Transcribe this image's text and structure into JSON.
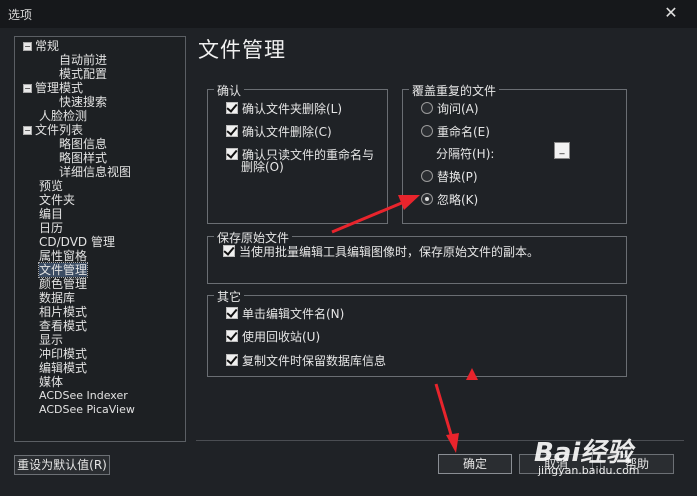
{
  "window": {
    "title": "选项",
    "close_glyph": "✕"
  },
  "tree": {
    "items": [
      {
        "label": "常规",
        "toggle": "−"
      },
      {
        "label": "自动前进"
      },
      {
        "label": "模式配置"
      },
      {
        "label": "管理模式",
        "toggle": "−"
      },
      {
        "label": "快速搜索"
      },
      {
        "label": "人脸检测"
      },
      {
        "label": "文件列表",
        "toggle": "−"
      },
      {
        "label": "略图信息"
      },
      {
        "label": "略图样式"
      },
      {
        "label": "详细信息视图"
      },
      {
        "label": "预览"
      },
      {
        "label": "文件夹"
      },
      {
        "label": "编目"
      },
      {
        "label": "日历"
      },
      {
        "label": "CD/DVD 管理"
      },
      {
        "label": "属性窗格"
      },
      {
        "label": "文件管理",
        "selected": true
      },
      {
        "label": "颜色管理"
      },
      {
        "label": "数据库"
      },
      {
        "label": "相片模式"
      },
      {
        "label": "查看模式"
      },
      {
        "label": "显示"
      },
      {
        "label": "冲印模式"
      },
      {
        "label": "编辑模式"
      },
      {
        "label": "媒体"
      },
      {
        "label": "ACDSee Indexer"
      },
      {
        "label": "ACDSee PicaView"
      }
    ]
  },
  "page_title": "文件管理",
  "confirm_group": {
    "legend": "确认",
    "items": [
      {
        "label": "确认文件夹删除(L)",
        "checked": true
      },
      {
        "label": "确认文件删除(C)",
        "checked": true
      },
      {
        "label": "确认只读文件的重命名与",
        "label2": "删除(O)",
        "checked": true
      }
    ]
  },
  "overwrite_group": {
    "legend": "覆盖重复的文件",
    "options": [
      {
        "label": "询问(A)",
        "selected": false
      },
      {
        "label": "重命名(E)",
        "selected": false
      },
      {
        "label": "替换(P)",
        "selected": false
      },
      {
        "label": "忽略(K)",
        "selected": true
      }
    ],
    "separator_label": "分隔符(H):",
    "separator_value": "_"
  },
  "preserve_group": {
    "legend": "保存原始文件",
    "item": {
      "label": "当使用批量编辑工具编辑图像时，保存原始文件的副本。",
      "checked": true
    }
  },
  "other_group": {
    "legend": "其它",
    "items": [
      {
        "label": "单击编辑文件名(N)",
        "checked": true
      },
      {
        "label": "使用回收站(U)",
        "checked": true
      },
      {
        "label": "复制文件时保留数据库信息",
        "checked": true
      }
    ]
  },
  "buttons": {
    "reset": "重设为默认值(R)",
    "ok": "确定",
    "cancel": "取消",
    "help": "帮助"
  },
  "watermark": {
    "brand": "Bai经验",
    "url": "jingyan.baidu.com"
  },
  "colors": {
    "annotation_arrow": "#e8242c",
    "background": "#1f2226"
  }
}
